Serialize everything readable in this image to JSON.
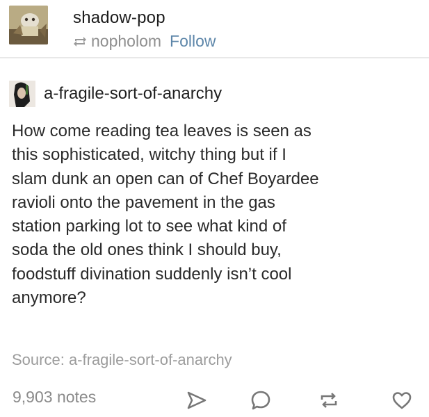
{
  "header": {
    "blog_name": "shadow-pop",
    "reblogged_from": "nopholom",
    "follow_label": "Follow",
    "avatar_icon": "blog-avatar-icon",
    "reblog_icon": "reblog-small-icon"
  },
  "post": {
    "author": "a-fragile-sort-of-anarchy",
    "author_avatar_icon": "author-avatar-icon",
    "body_lines": [
      "How come reading tea leaves is seen as",
      "this sophisticated, witchy thing but if I",
      "slam dunk an open can of Chef Boyardee",
      "ravioli onto the pavement in the gas",
      "station parking lot to see what kind of",
      "soda the old ones think I should buy,",
      "foodstuff divination suddenly isn’t cool",
      "anymore?"
    ],
    "source_prefix": "Source: ",
    "source_name": "a-fragile-sort-of-anarchy"
  },
  "footer": {
    "notes": "9,903 notes",
    "actions": [
      "share-icon",
      "reply-icon",
      "reblog-icon",
      "heart-icon"
    ]
  },
  "colors": {
    "follow": "#5d86a9",
    "muted": "#8f8f8f",
    "text": "#2a2a2a"
  }
}
